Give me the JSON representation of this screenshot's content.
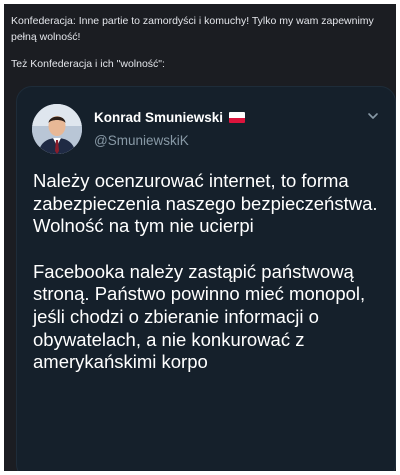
{
  "caption": {
    "line1": "Konfederacja: Inne partie to zamordyści i komuchy! Tylko my wam zapewnimy pełną wolność!",
    "line2": "Też Konfederacja i ich \"wolność\":"
  },
  "tweet": {
    "display_name": "Konrad Smuniewski",
    "handle": "@SmuniewskiK",
    "paragraph1": "Należy ocenzurować internet, to forma zabezpieczenia naszego bezpieczeństwa. Wolność na tym nie ucierpi",
    "paragraph2": "Facebooka należy zastąpić państwową stroną. Państwo powinno mieć monopol, jeśli chodzi o zbieranie informacji o obywatelach, a nie konkurować z amerykańskimi korpo"
  },
  "icons": {
    "avatar": "profile-photo",
    "flag": "poland-flag-icon",
    "menu": "chevron-down-icon"
  },
  "colors": {
    "page_background": "#1b1d22",
    "card_background": "#15202b",
    "text_primary": "#ffffff",
    "text_secondary": "#8899a6",
    "flag_red": "#dc143c"
  }
}
